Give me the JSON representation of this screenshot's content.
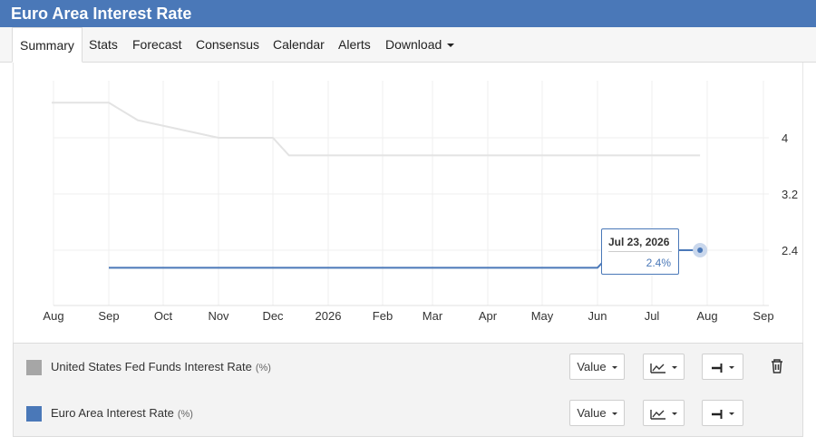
{
  "header": {
    "title": "Euro Area Interest Rate"
  },
  "tabs": [
    {
      "label": "Summary"
    },
    {
      "label": "Stats"
    },
    {
      "label": "Forecast"
    },
    {
      "label": "Consensus"
    },
    {
      "label": "Calendar"
    },
    {
      "label": "Alerts"
    },
    {
      "label": "Download"
    }
  ],
  "tooltip": {
    "date": "Jul 23, 2026",
    "value": "2.4%"
  },
  "legend": [
    {
      "name": "United States Fed Funds Interest Rate",
      "unit": "(%)",
      "color": "#a6a6a6",
      "value_label": "Value"
    },
    {
      "name": "Euro Area Interest Rate",
      "unit": "(%)",
      "color": "#4a78b8",
      "value_label": "Value"
    }
  ],
  "colors": {
    "header": "#4a78b8",
    "us_series": "#e3e3e3",
    "ea_series": "#4a78b8"
  },
  "icons": {
    "chart_type": "line-chart-icon",
    "style": "line-style-icon",
    "delete": "trash-icon"
  },
  "chart_data": {
    "type": "line",
    "x_ticks": [
      "Aug",
      "Sep",
      "Oct",
      "Nov",
      "Dec",
      "2026",
      "Feb",
      "Mar",
      "Apr",
      "May",
      "Jun",
      "Jul",
      "Aug",
      "Sep"
    ],
    "y_ticks": [
      2.4,
      3.2,
      4
    ],
    "ylim": [
      1.7,
      4.6
    ],
    "grid": true,
    "series": [
      {
        "name": "United States Fed Funds Interest Rate",
        "points": [
          {
            "x": "2025-07-31",
            "y": 4.5
          },
          {
            "x": "2025-09-01",
            "y": 4.5
          },
          {
            "x": "2025-09-17",
            "y": 4.25
          },
          {
            "x": "2025-11-01",
            "y": 4.0
          },
          {
            "x": "2025-12-01",
            "y": 4.0
          },
          {
            "x": "2025-12-10",
            "y": 3.75
          },
          {
            "x": "2026-07-28",
            "y": 3.75
          }
        ]
      },
      {
        "name": "Euro Area Interest Rate",
        "points": [
          {
            "x": "2025-09-01",
            "y": 2.15
          },
          {
            "x": "2026-06-01",
            "y": 2.15
          },
          {
            "x": "2026-06-10",
            "y": 2.4
          },
          {
            "x": "2026-07-28",
            "y": 2.4
          }
        ]
      }
    ]
  }
}
